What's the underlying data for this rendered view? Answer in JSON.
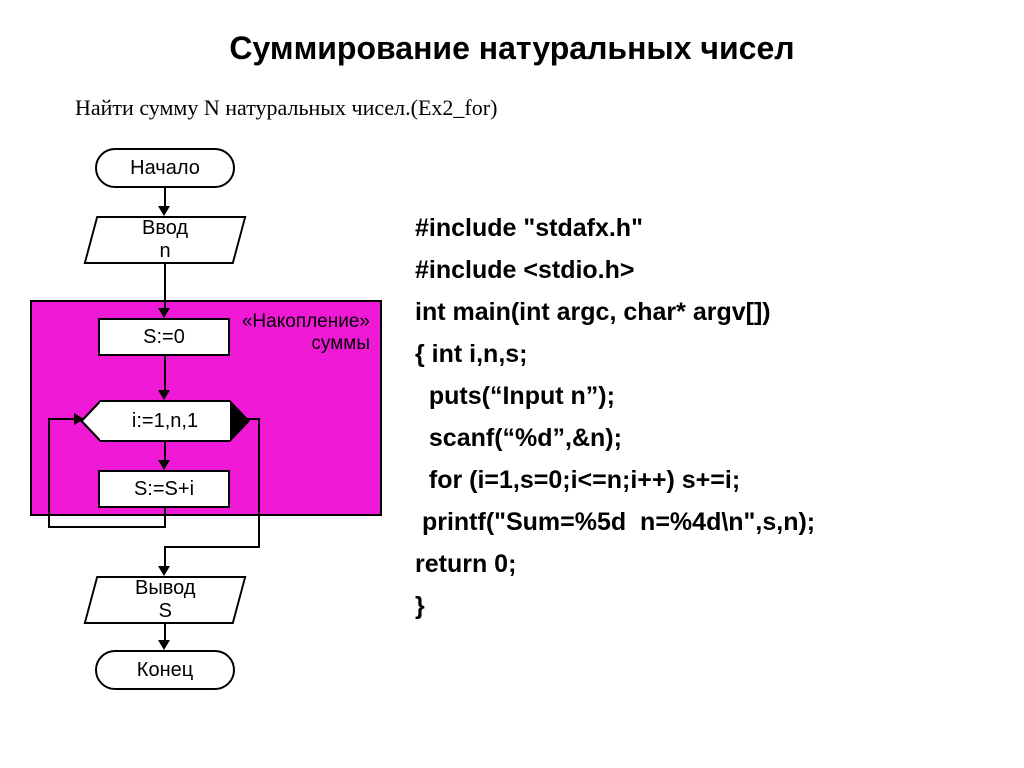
{
  "title": "Суммирование натуральных чисел",
  "subtitle": "Найти сумму N натуральных чисел.(Ex2_for)",
  "flowchart": {
    "start": "Начало",
    "input": "Ввод\nn",
    "init": "S:=0",
    "accum_label_1": "«Накопление»",
    "accum_label_2": "суммы",
    "loop": "i:=1,n,1",
    "body": "S:=S+i",
    "output": "Вывод\nS",
    "end": "Конец"
  },
  "code": {
    "l1": "#include \"stdafx.h\"",
    "l2": "#include <stdio.h>",
    "l3": "int main(int argc, char* argv[])",
    "l4": "{ int i,n,s;",
    "l5": "  puts(“Input n”);",
    "l6": "  scanf(“%d”,&n);",
    "l7": "  for (i=1,s=0;i<=n;i++) s+=i;",
    "l8": " printf(\"Sum=%5d  n=%4d\\n\",s,n);",
    "l9": "return 0;",
    "l10": "}"
  }
}
